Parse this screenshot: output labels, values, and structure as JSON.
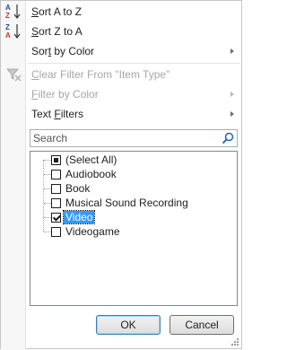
{
  "menu": {
    "sort_az": {
      "pre": "",
      "mn": "S",
      "post": "ort A to Z"
    },
    "sort_za": {
      "pre": "",
      "mn": "S",
      "post": "ort Z to A"
    },
    "sort_color": {
      "pre": "Sor",
      "mn": "t",
      "post": " by Color"
    },
    "clear_filter": {
      "pre": "",
      "mn": "C",
      "post": "lear Filter From \"Item Type\""
    },
    "filter_color": {
      "pre": "",
      "mn": "F",
      "post": "ilter by Color"
    },
    "text_filters": {
      "pre": "",
      "mn": "F",
      "post": "ilters",
      "prefix": "Text "
    }
  },
  "search": {
    "placeholder": "Search"
  },
  "tree": {
    "items": [
      {
        "label": "(Select All)",
        "state": "indeterminate"
      },
      {
        "label": "Audiobook",
        "state": "unchecked"
      },
      {
        "label": "Book",
        "state": "unchecked"
      },
      {
        "label": "Musical Sound Recording",
        "state": "unchecked"
      },
      {
        "label": "Video",
        "state": "checked"
      },
      {
        "label": "Videogame",
        "state": "unchecked"
      }
    ]
  },
  "buttons": {
    "ok": "OK",
    "cancel": "Cancel"
  },
  "icons": {
    "sort_az": "sort-ascending-icon",
    "sort_za": "sort-descending-icon",
    "clear_filter": "clear-filter-icon",
    "search": "magnifier-icon"
  },
  "colors": {
    "accent": "#3399ff",
    "disabled_text": "#a6a6a6"
  }
}
